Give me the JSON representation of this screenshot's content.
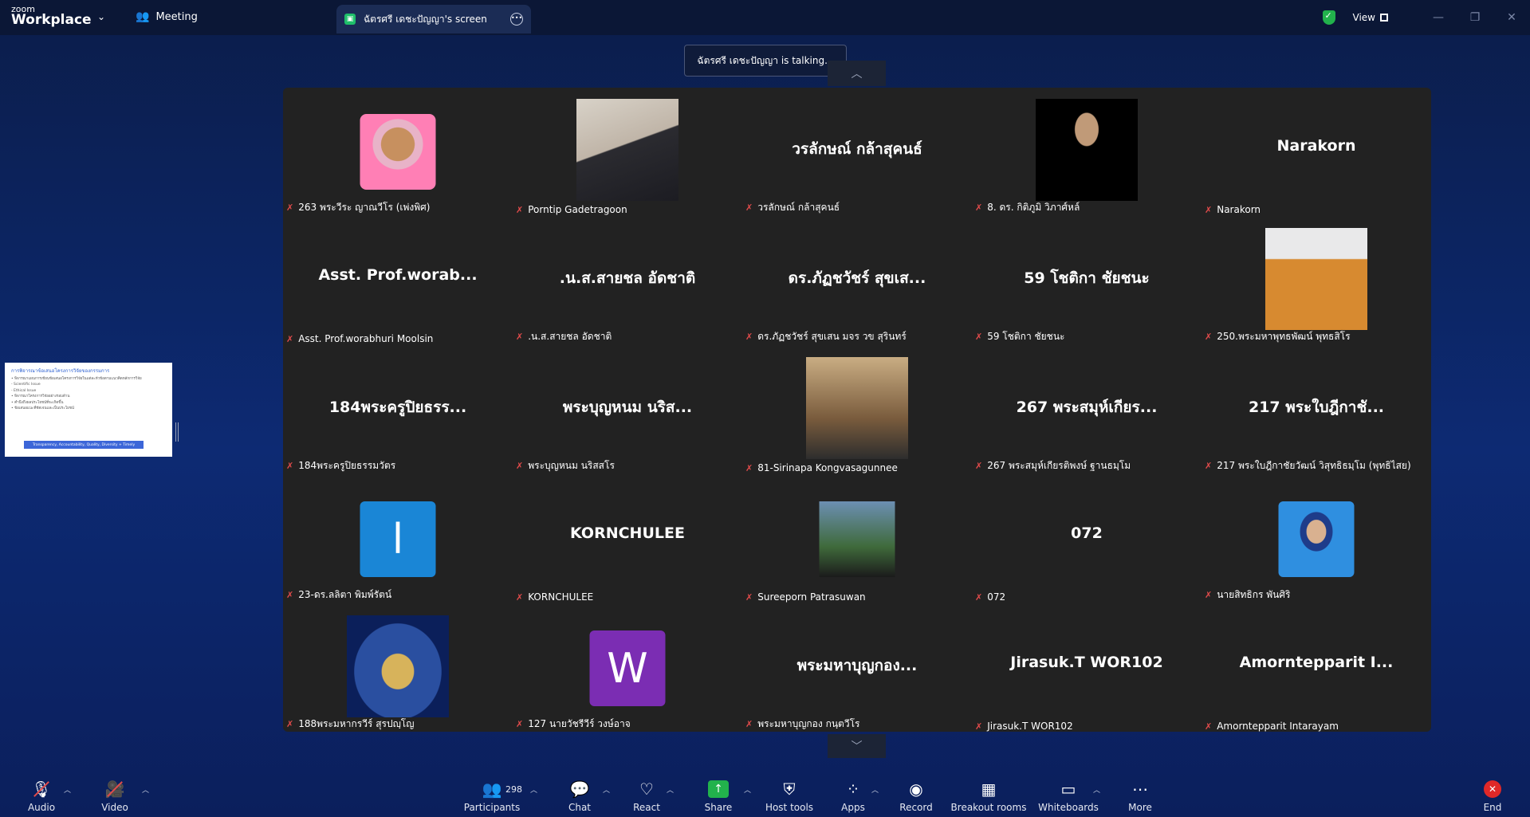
{
  "titlebar": {
    "brand_top": "zoom",
    "brand_bottom": "Workplace",
    "meeting_label": "Meeting",
    "screen_tab_label": "ฉัตรศรี เดชะปัญญา's screen",
    "view_label": "View"
  },
  "notification": {
    "talking": "ฉัตรศรี เดชะปัญญา is talking..."
  },
  "thumbnail": {
    "title": "การพิจารณาข้อเสนอโครงการวิจัยของกรรมการ",
    "lines": [
      "• พิจารณาแผนการเขียนข้อเสนอโครงการวิจัยในแต่ละหัวข้อตามแนวคิดหลักการวิจัย",
      "   - Scientific Issue",
      "   - Ethical Issue",
      "• พิจารณาโครงการวิจัยอย่างรอบด้าน",
      "• คำนึงถึงผลประโยชน์ที่จะเกิดขึ้น",
      "• ข้อเสนอแนะที่ชัดเจนและเป็นประโยชน์"
    ],
    "bar": "Transparency, Accountability, Quality, Diversity + Timely"
  },
  "participants": [
    {
      "label": "263 พระวีระ ญาณวีโร (เพ่งพิศ)",
      "display": "",
      "type": "photo",
      "photo": "ph-monk-circle",
      "size": "small"
    },
    {
      "label": "Porntip Gadetragoon",
      "display": "",
      "type": "photo",
      "photo": "ph-woman",
      "size": "big"
    },
    {
      "label": "วรลักษณ์ กล้าสุคนธ์",
      "display": "วรลักษณ์ กล้าสุคนธ์",
      "type": "name"
    },
    {
      "label": "8. ดร. กิติภูมิ วิภาศ์หล์",
      "display": "",
      "type": "photo",
      "photo": "ph-man",
      "size": "big"
    },
    {
      "label": "Narakorn",
      "display": "Narakorn",
      "type": "name"
    },
    {
      "label": "Asst. Prof.worabhuri Moolsin",
      "display": "Asst. Prof.worab...",
      "type": "name"
    },
    {
      "label": ".น.ส.สายชล อัดชาติ",
      "display": ".น.ส.สายชล อัดชาติ",
      "type": "name"
    },
    {
      "label": "ดร.ภัฏชวัชร์ สุขเสน มจร วข สุรินทร์",
      "display": "ดร.ภัฏชวัชร์ สุขเส...",
      "type": "name"
    },
    {
      "label": "59 โชติกา ชัยชนะ",
      "display": "59 โชติกา ชัยชนะ",
      "type": "name"
    },
    {
      "label": "250.พระมหาพุทธพัฒน์ พุทธสิโร",
      "display": "",
      "type": "photo",
      "photo": "ph-orange-monk",
      "size": "big"
    },
    {
      "label": "184พระครูปิยธรรมวัตร",
      "display": "184พระครูปิยธรร...",
      "type": "name"
    },
    {
      "label": "พระบุญหนม นริสสโร",
      "display": "พระบุญหนม นริส...",
      "type": "name"
    },
    {
      "label": "81-Sirinapa Kongvasagunnee",
      "display": "",
      "type": "photo",
      "photo": "ph-girl",
      "size": "big"
    },
    {
      "label": "267 พระสมุห์เกียรติพงษ์ ฐานธมฺโม",
      "display": "267 พระสมุห์เกียร...",
      "type": "name"
    },
    {
      "label": "217 พระใบฎีกาชัยวัฒน์ วิสุทธิธมฺโม (พุทธิไสย)",
      "display": "217 พระใบฎีกาชั...",
      "type": "name"
    },
    {
      "label": "23-ดร.ลลิตา พิมพ์รัตน์",
      "display": "",
      "type": "letter",
      "letter": "l",
      "color": "#1a86d6"
    },
    {
      "label": "KORNCHULEE",
      "display": "KORNCHULEE",
      "type": "name"
    },
    {
      "label": "Sureeporn Patrasuwan",
      "display": "",
      "type": "photo",
      "photo": "ph-lady",
      "size": "small"
    },
    {
      "label": "072",
      "display": "072",
      "type": "name"
    },
    {
      "label": "นายสิทธิกร พันศิริ",
      "display": "",
      "type": "photo",
      "photo": "ph-young",
      "size": "small"
    },
    {
      "label": "188พระมหากรวีร์ สุรปญฺโญ",
      "display": "",
      "type": "photo",
      "photo": "ph-buddha",
      "size": "big"
    },
    {
      "label": "127 นายวัชรีวีร์ วงษ์อาจ",
      "display": "",
      "type": "letter",
      "letter": "W",
      "color": "#7b2db3"
    },
    {
      "label": "พระมหาบุญกอง กนฺตวีโร",
      "display": "พระมหาบุญกอง...",
      "type": "name"
    },
    {
      "label": "Jirasuk.T WOR102",
      "display": "Jirasuk.T WOR102",
      "type": "name"
    },
    {
      "label": "Amorntepparit Intarayam",
      "display": "Amorntepparit I...",
      "type": "name"
    }
  ],
  "toolbar": {
    "audio": "Audio",
    "video": "Video",
    "participants": "Participants",
    "participants_count": "298",
    "chat": "Chat",
    "react": "React",
    "share": "Share",
    "host_tools": "Host tools",
    "apps": "Apps",
    "record": "Record",
    "breakout": "Breakout rooms",
    "whiteboards": "Whiteboards",
    "more": "More",
    "end": "End"
  }
}
